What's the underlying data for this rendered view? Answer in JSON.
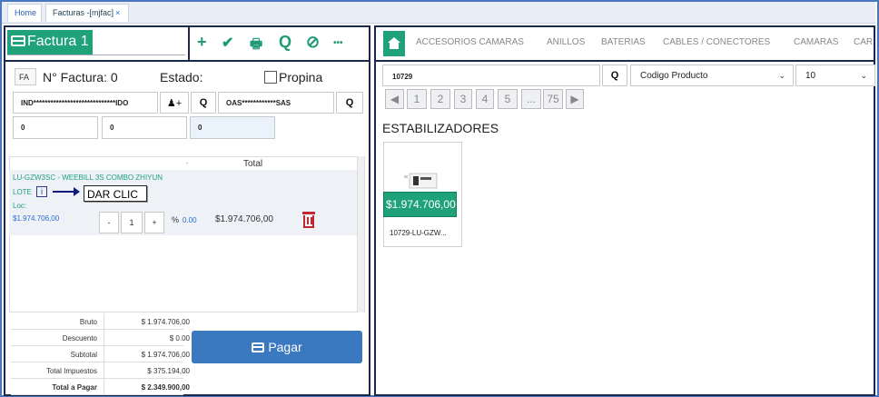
{
  "tabs": [
    {
      "label": "Home"
    },
    {
      "label": "Facturas -[mjfac]",
      "close": "×"
    }
  ],
  "header": {
    "title": "Factura 1",
    "toolbar": {
      "add": "+",
      "confirm": "✔",
      "print": "🖶",
      "search": "Q",
      "cancel": "⊘",
      "more": "•••"
    }
  },
  "invoice": {
    "badge": "FA",
    "number_label": "N° Factura: 0",
    "status_label": "Estado:",
    "tip_label": "Propina",
    "client_field": "IND*****************************IDO",
    "company_field": "OAS************SAS",
    "num_fields": [
      "0",
      "0",
      "0"
    ],
    "col_dot": ".",
    "col_total": "Total"
  },
  "item": {
    "name": "LU-GZW3SC - WEEBILL 3S COMBO ZHIYUN",
    "lote": "LOTE",
    "info_icon": "i",
    "loc": "Loc:",
    "price": "$1.974.706,00",
    "minus": "-",
    "qty": "1",
    "plus": "+",
    "pct": "%",
    "discount": "0.00",
    "total": "$1.974.706,00"
  },
  "callout": "DAR CLIC",
  "totals": [
    {
      "label": "Bruto",
      "value": "$ 1.974.706,00"
    },
    {
      "label": "Descuento",
      "value": "$ 0.00"
    },
    {
      "label": "Subtotal",
      "value": "$ 1.974.706,00"
    },
    {
      "label": "Total Impuestos",
      "value": "$ 375.194,00"
    },
    {
      "label": "Total a Pagar",
      "value": "$ 2.349.900,00"
    }
  ],
  "pay_button": "Pagar",
  "catalog": {
    "categories": [
      "ACCESORIOS CAMARAS",
      "ANILLOS",
      "BATERIAS",
      "CABLES / CONECTORES",
      "CAMARAS",
      "CAR"
    ],
    "search_value": "10729",
    "filter_select": "Codigo Producto",
    "page_size": "10",
    "pages": [
      "◀",
      "1",
      "2",
      "3",
      "4",
      "5",
      "...",
      "75",
      "▶"
    ],
    "section_title": "ESTABILIZADORES",
    "product": {
      "price": "$1.974.706,00",
      "name": "10729-LU-GZW..."
    }
  },
  "colors": {
    "accent": "#1fa27a",
    "primary": "#3a78c0",
    "border": "#1b2a4a",
    "delete": "#c0262d"
  }
}
